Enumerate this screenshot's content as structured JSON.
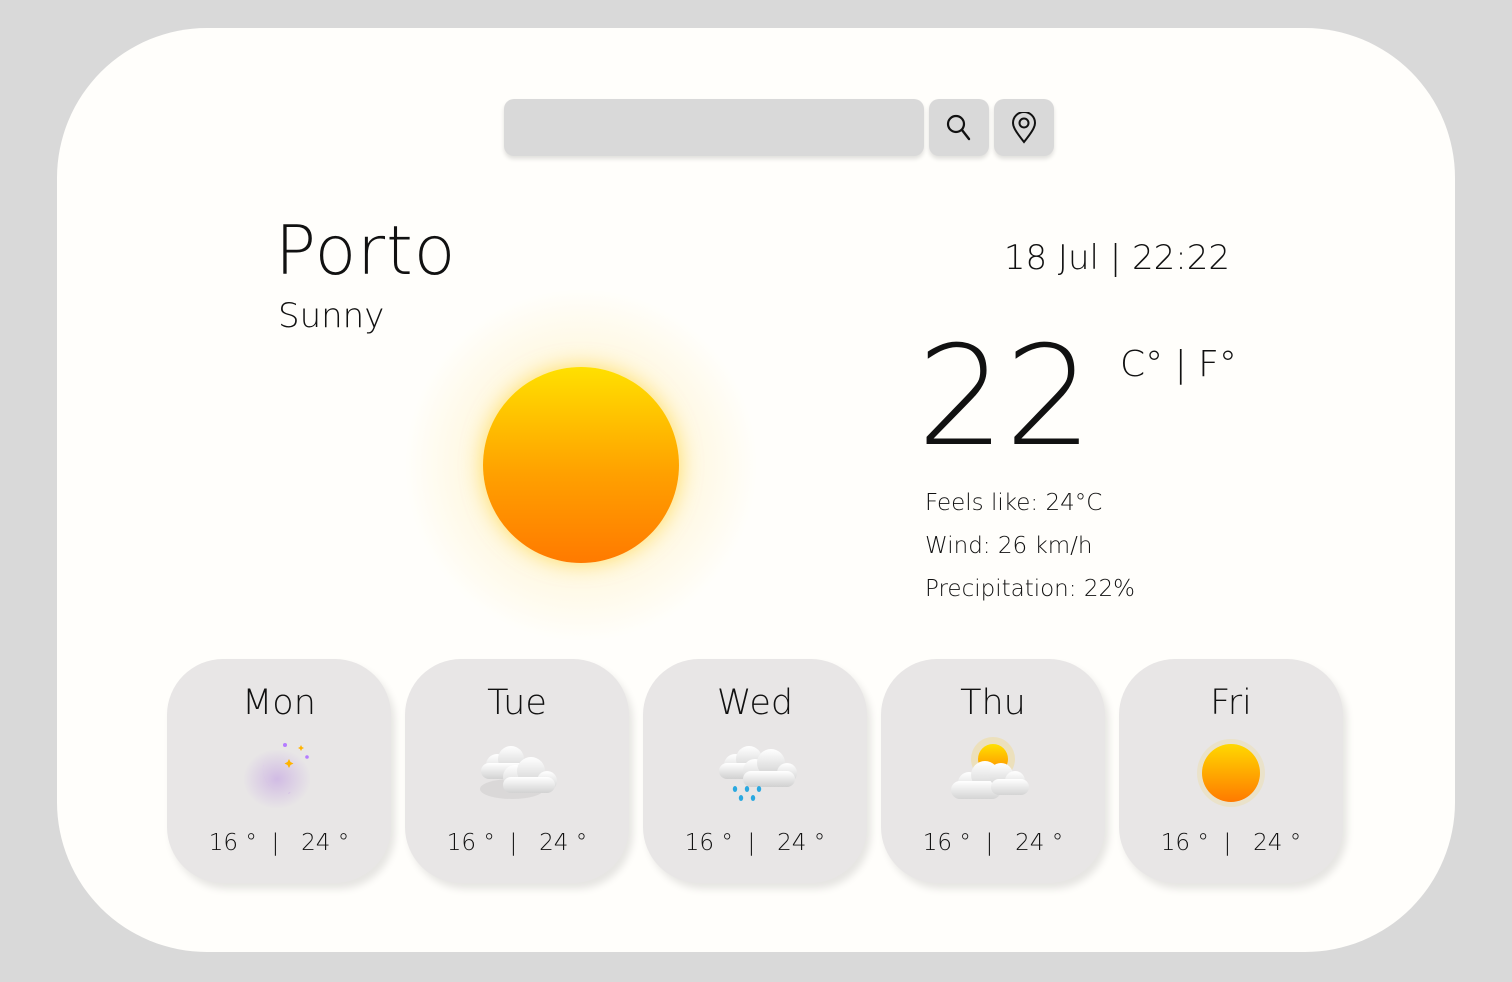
{
  "search": {
    "value": "",
    "placeholder": ""
  },
  "buttons": {
    "search_icon": "search-icon",
    "location_icon": "location-pin-icon"
  },
  "current": {
    "city": "Porto",
    "condition": "Sunny",
    "datetime": "18 Jul | 22:22",
    "temperature": "22",
    "units": "C° | F°",
    "icon": "sun-icon",
    "feels_like": "Feels like: 24°C",
    "wind": "Wind: 26 km/h",
    "precipitation": "Precipitation: 22%"
  },
  "forecast": [
    {
      "day": "Mon",
      "icon": "moon-stars-icon",
      "range": "16 °  |   24 °"
    },
    {
      "day": "Tue",
      "icon": "cloudy-icon",
      "range": "16 °  |   24 °"
    },
    {
      "day": "Wed",
      "icon": "rain-cloud-icon",
      "range": "16 °  |   24 °"
    },
    {
      "day": "Thu",
      "icon": "partly-cloudy-icon",
      "range": "16 °  |   24 °"
    },
    {
      "day": "Fri",
      "icon": "sun-icon",
      "range": "16 °  |   24 °"
    }
  ],
  "colors": {
    "background": "#d9d9d9",
    "card": "#fffefb",
    "sun_top": "#ffe000",
    "sun_bottom": "#ff7a00",
    "day_card": "#e8e6e6",
    "moon": "#a259ff"
  }
}
